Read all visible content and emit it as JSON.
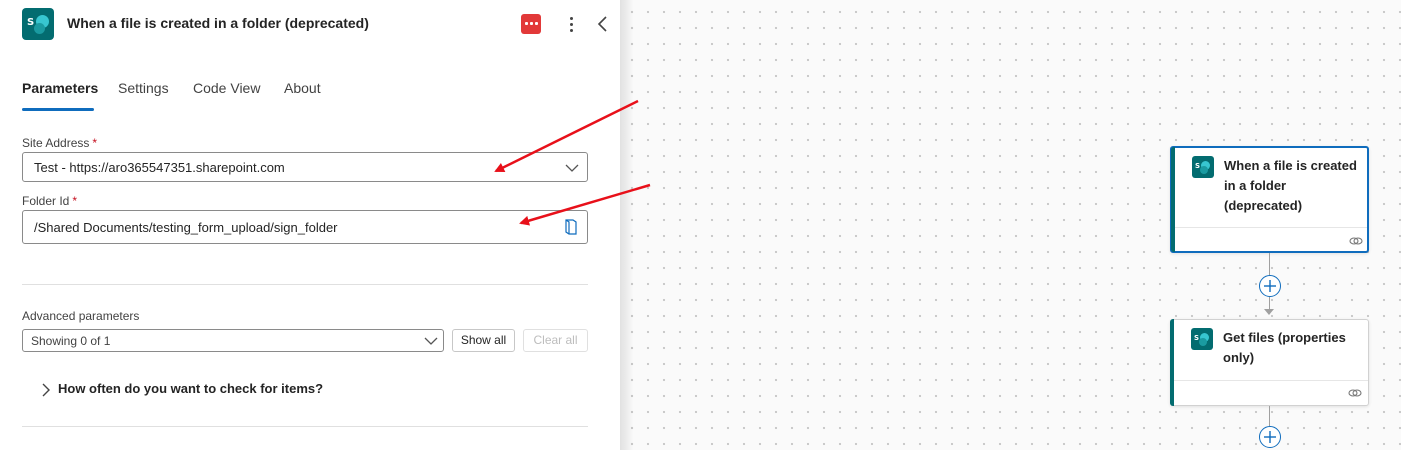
{
  "panel": {
    "title": "When a file is created in a folder (deprecated)",
    "tabs": [
      {
        "label": "Parameters",
        "active": true
      },
      {
        "label": "Settings",
        "active": false
      },
      {
        "label": "Code View",
        "active": false
      },
      {
        "label": "About",
        "active": false
      }
    ],
    "site_address": {
      "label": "Site Address",
      "required_mark": "*",
      "value": "Test - https://aro365547351.sharepoint.com"
    },
    "folder_id": {
      "label": "Folder Id",
      "required_mark": "*",
      "value": "/Shared Documents/testing_form_upload/sign_folder"
    },
    "advanced": {
      "label": "Advanced parameters",
      "value": "Showing 0 of 1",
      "show_all": "Show all",
      "clear_all": "Clear all"
    },
    "expander_label": "How often do you want to check for items?",
    "icons": {
      "app": "sharepoint-logo-icon",
      "connection": "connection-warning-icon",
      "more": "more-options-icon",
      "collapse": "chevron-left-icon",
      "folder_picker": "folder-picker-icon"
    },
    "colors": {
      "accent": "#0f6cbd",
      "sharepoint": "#036c70",
      "warning": "#e23939",
      "annotation": "#e8101a"
    }
  },
  "flow": {
    "cards": [
      {
        "title": "When a file is created in a folder (deprecated)",
        "selected": true
      },
      {
        "title": "Get files (properties only)",
        "selected": false
      }
    ]
  }
}
